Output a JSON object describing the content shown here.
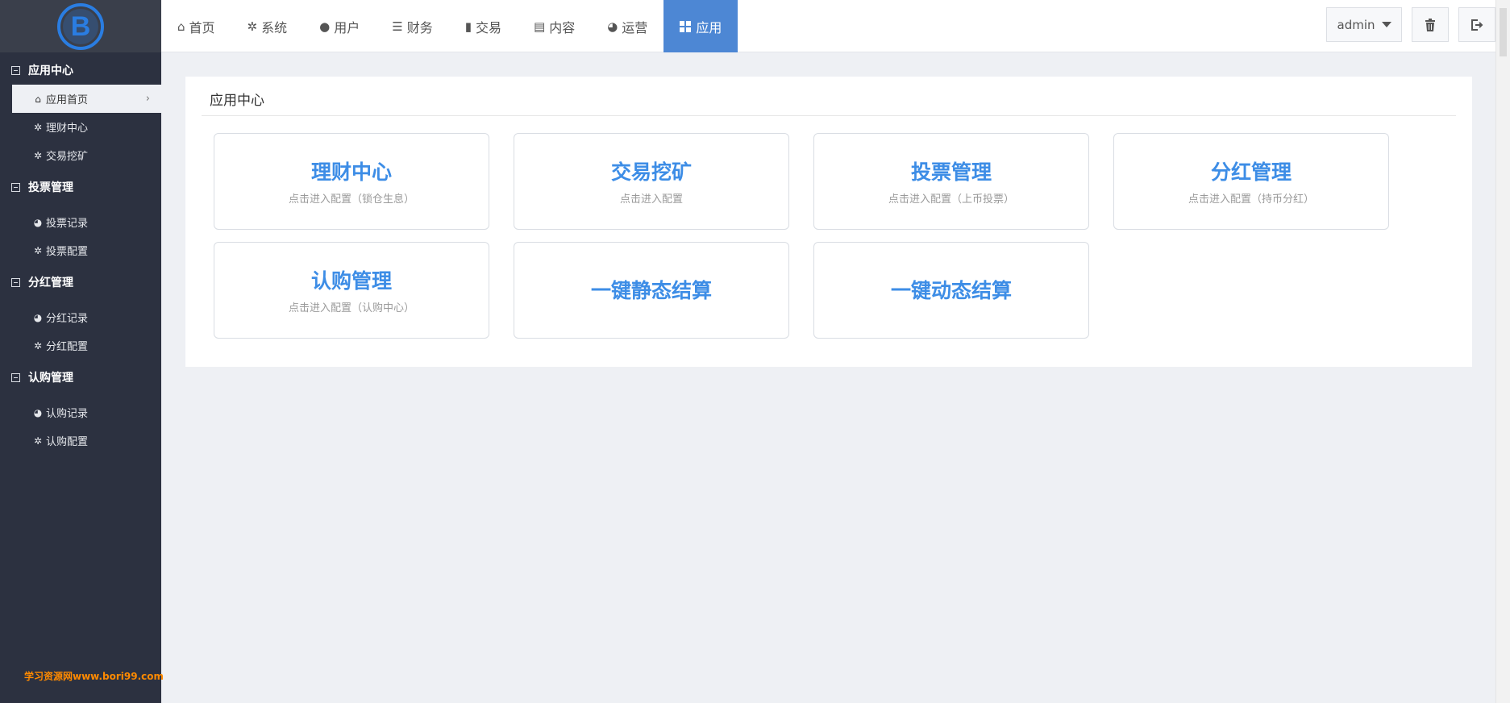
{
  "sidebar": {
    "groups": [
      {
        "label": "应用中心",
        "items": [
          {
            "label": "应用首页",
            "icon": "home-icon",
            "glyph": "⌂",
            "active": true
          },
          {
            "label": "理财中心",
            "icon": "gear-icon",
            "glyph": "✲"
          },
          {
            "label": "交易挖矿",
            "icon": "gear-icon",
            "glyph": "✲"
          }
        ]
      },
      {
        "label": "投票管理",
        "items": [
          {
            "label": "投票记录",
            "icon": "globe-icon",
            "glyph": "◕"
          },
          {
            "label": "投票配置",
            "icon": "gear-icon",
            "glyph": "✲"
          }
        ]
      },
      {
        "label": "分红管理",
        "items": [
          {
            "label": "分红记录",
            "icon": "globe-icon",
            "glyph": "◕"
          },
          {
            "label": "分红配置",
            "icon": "gear-icon",
            "glyph": "✲"
          }
        ]
      },
      {
        "label": "认购管理",
        "items": [
          {
            "label": "认购记录",
            "icon": "globe-icon",
            "glyph": "◕"
          },
          {
            "label": "认购配置",
            "icon": "gear-icon",
            "glyph": "✲"
          }
        ]
      }
    ],
    "watermark": "学习资源网www.bori99.com"
  },
  "topnav": {
    "items": [
      {
        "label": "首页",
        "icon": "home-icon"
      },
      {
        "label": "系统",
        "icon": "gear-icon"
      },
      {
        "label": "用户",
        "icon": "user-icon"
      },
      {
        "label": "财务",
        "icon": "list-icon"
      },
      {
        "label": "交易",
        "icon": "bar-chart-icon"
      },
      {
        "label": "内容",
        "icon": "document-icon"
      },
      {
        "label": "运营",
        "icon": "globe-icon"
      },
      {
        "label": "应用",
        "icon": "grid-icon",
        "active": true
      }
    ],
    "user_label": "admin"
  },
  "main": {
    "title": "应用中心",
    "cards": [
      {
        "title": "理财中心",
        "subtitle": "点击进入配置（锁仓生息）"
      },
      {
        "title": "交易挖矿",
        "subtitle": "点击进入配置"
      },
      {
        "title": "投票管理",
        "subtitle": "点击进入配置（上币投票）"
      },
      {
        "title": "分红管理",
        "subtitle": "点击进入配置（持币分红）"
      },
      {
        "title": "认购管理",
        "subtitle": "点击进入配置（认购中心）"
      },
      {
        "title": "一键静态结算",
        "subtitle": ""
      },
      {
        "title": "一键动态结算",
        "subtitle": ""
      }
    ]
  },
  "colors": {
    "sidebar_bg": "#2c3140",
    "accent": "#4d87d4",
    "card_title": "#3d8de6",
    "watermark": "#ff8a00"
  }
}
